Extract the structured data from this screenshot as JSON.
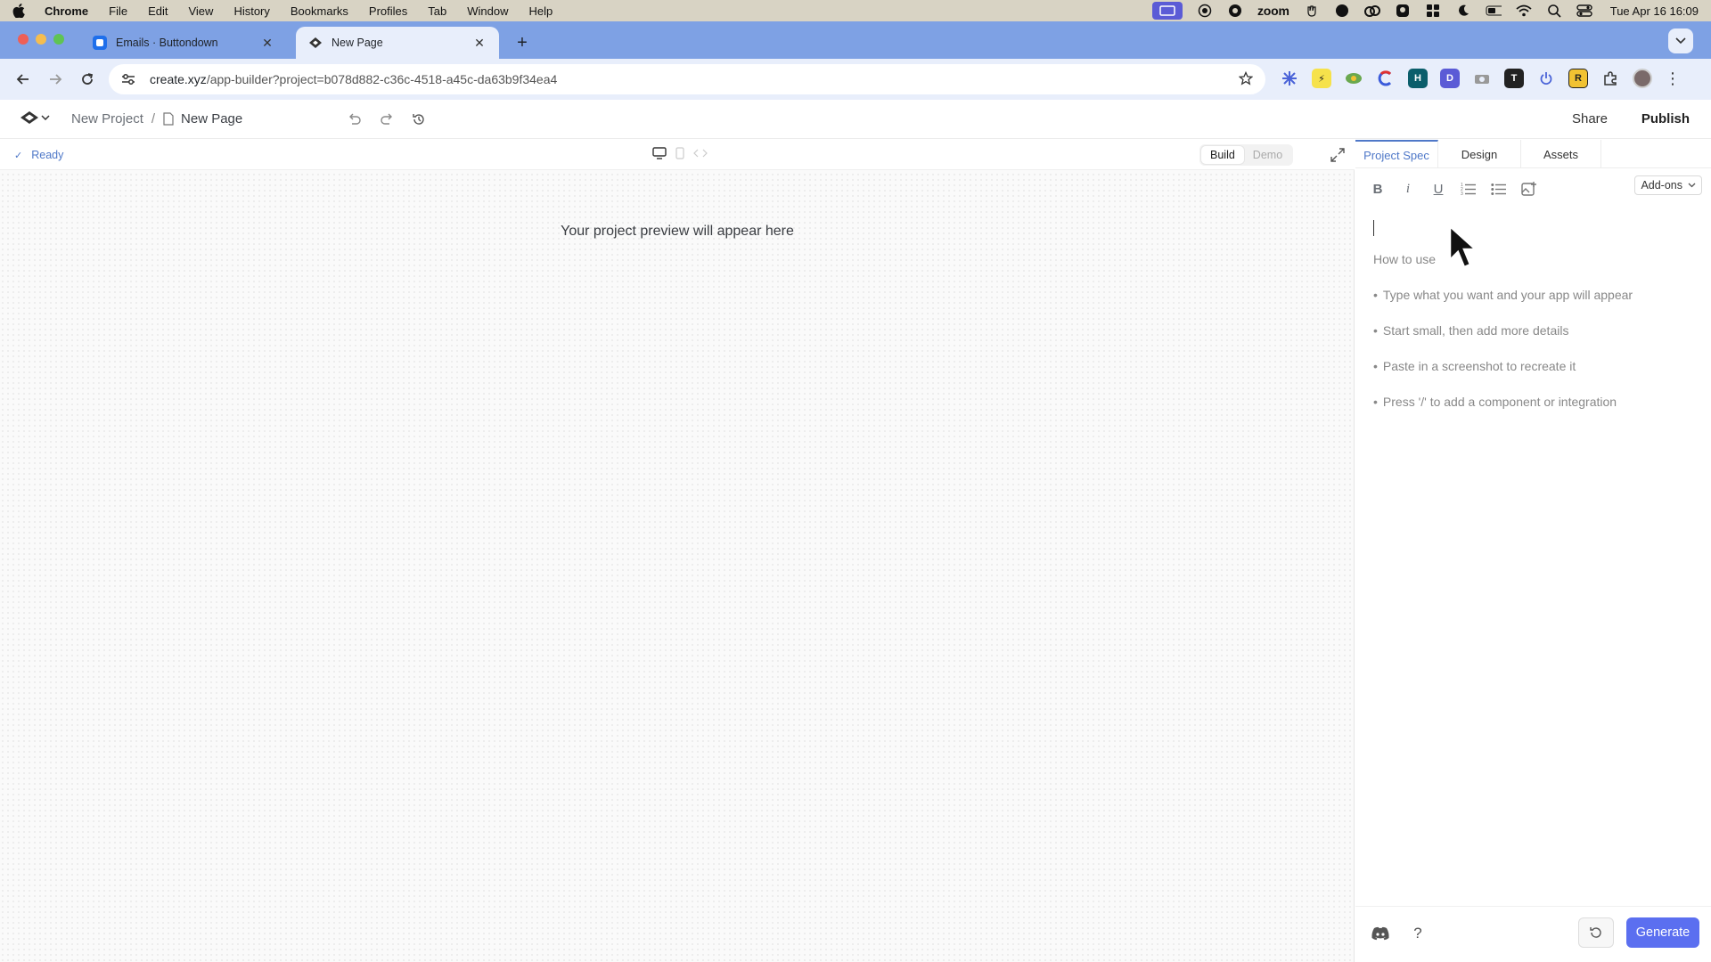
{
  "menubar": {
    "app_name": "Chrome",
    "items": [
      "File",
      "Edit",
      "View",
      "History",
      "Bookmarks",
      "Profiles",
      "Tab",
      "Window",
      "Help"
    ],
    "zoom_label": "zoom",
    "clock": "Tue Apr 16  16:09"
  },
  "browser": {
    "tabs": [
      {
        "title": "Emails · Buttondown",
        "icon": "buttondown-icon"
      },
      {
        "title": "New Page",
        "icon": "create-logo-icon"
      }
    ],
    "url_domain": "create.xyz",
    "url_path": "/app-builder?project=b078d882-c36c-4518-a45c-da63b9f34ea4"
  },
  "app": {
    "breadcrumb": {
      "project": "New Project",
      "separator": "/",
      "page": "New Page"
    },
    "share_label": "Share",
    "publish_label": "Publish"
  },
  "preview": {
    "status": "Ready",
    "mode_build": "Build",
    "mode_demo": "Demo",
    "message": "Your project preview will appear here"
  },
  "panel": {
    "tabs": [
      "Project Spec",
      "Design",
      "Assets"
    ],
    "addons_label": "Add-ons",
    "heading": "How to use",
    "tips": [
      "Type what you want and your app will appear",
      "Start small, then add more details",
      "Paste in a screenshot to recreate it",
      "Press '/' to add a component or integration"
    ],
    "help_label": "?",
    "generate_label": "Generate"
  },
  "colors": {
    "accent": "#4f78c8",
    "generate": "#5b6ff0",
    "tabstrip": "#7ea1e4"
  }
}
